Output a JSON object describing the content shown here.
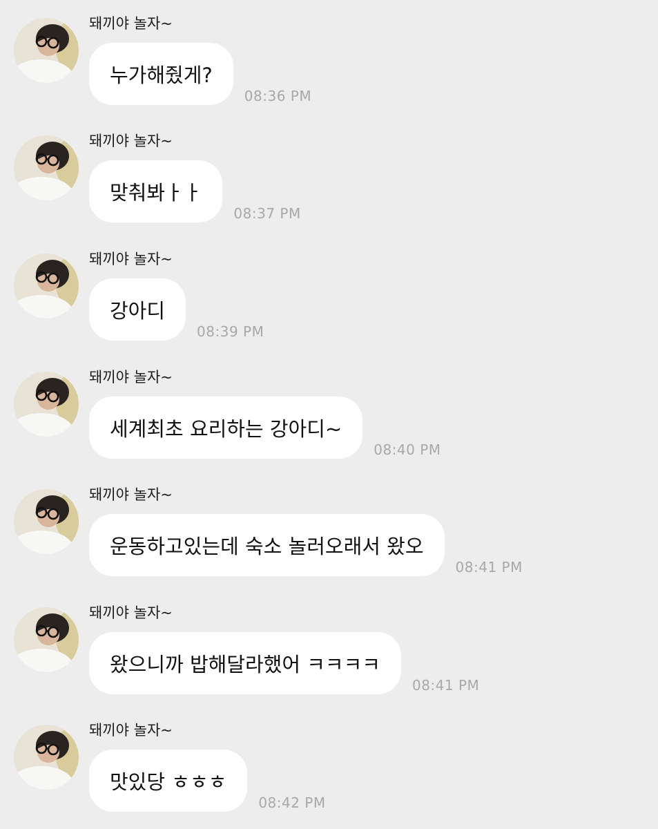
{
  "chat": {
    "messages": [
      {
        "sender": "돼끼야 놀자~",
        "text": "누가해줬게?",
        "time": "08:36 PM"
      },
      {
        "sender": "돼끼야 놀자~",
        "text": "맞춰봐ㅏㅏ",
        "time": "08:37 PM"
      },
      {
        "sender": "돼끼야 놀자~",
        "text": "강아디",
        "time": "08:39 PM"
      },
      {
        "sender": "돼끼야 놀자~",
        "text": "세계최초 요리하는 강아디~",
        "time": "08:40 PM"
      },
      {
        "sender": "돼끼야 놀자~",
        "text": "운동하고있는데 숙소 놀러오래서 왔오",
        "time": "08:41 PM"
      },
      {
        "sender": "돼끼야 놀자~",
        "text": "왔으니까 밥해달라했어 ㅋㅋㅋㅋ",
        "time": "08:41 PM"
      },
      {
        "sender": "돼끼야 놀자~",
        "text": "맛있당 ㅎㅎㅎ",
        "time": "08:42 PM"
      }
    ]
  },
  "colors": {
    "background": "#ededed",
    "bubble": "#ffffff",
    "timestamp": "#a8a8a8"
  }
}
